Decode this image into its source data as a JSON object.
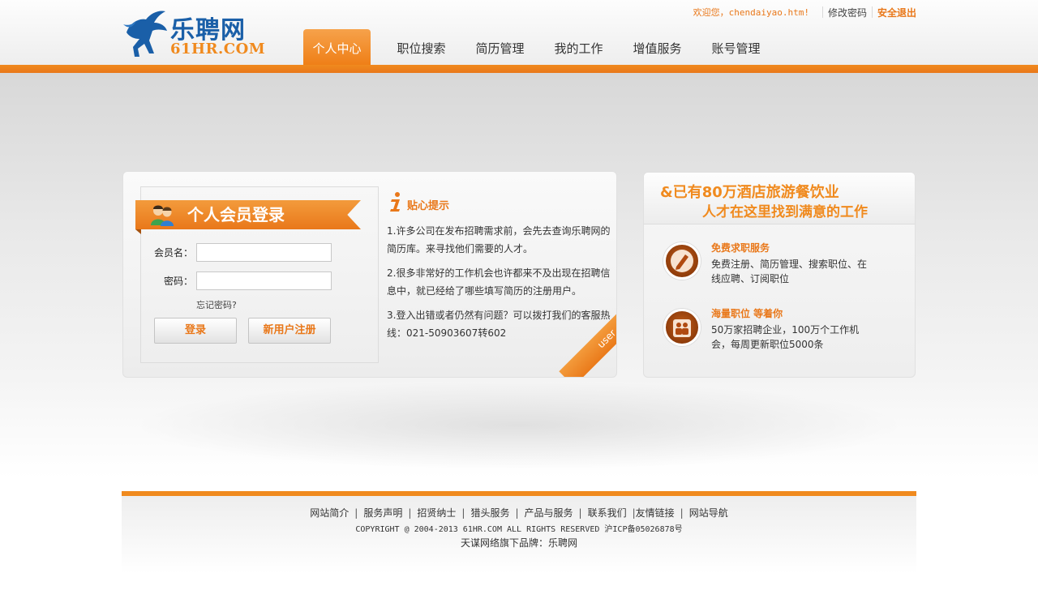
{
  "logo": {
    "cn": "乐聘网",
    "en": "61HR.COM"
  },
  "topbar": {
    "welcome": "欢迎您，chendaiyao.htm!",
    "change_password": "修改密码",
    "logout": "安全退出"
  },
  "nav": {
    "tabs": [
      {
        "label": "个人中心"
      },
      {
        "label": "职位搜索"
      },
      {
        "label": "简历管理"
      },
      {
        "label": "我的工作"
      },
      {
        "label": "增值服务"
      },
      {
        "label": "账号管理"
      }
    ]
  },
  "login": {
    "title": "个人会员登录",
    "username_label": "会员名：",
    "password_label": "密码：",
    "forgot": "忘记密码?",
    "login_button": "登录",
    "register_button": "新用户注册",
    "corner_text": "user"
  },
  "tips": {
    "title": "贴心提示",
    "items": [
      "1.许多公司在发布招聘需求前，会先去查询乐聘网的简历库。来寻找他们需要的人才。",
      "2.很多非常好的工作机会也许都来不及出现在招聘信息中，就已经给了哪些填写简历的注册用户。",
      "3.登入出错或者仍然有问题？可以拨打我们的客服热线：021-50903607转602"
    ]
  },
  "promo": {
    "line1": "&已有80万酒店旅游餐饮业",
    "line2": "人才在这里找到满意的工作",
    "services": [
      {
        "icon": "pen-icon",
        "title": "免费求职服务",
        "desc": "免费注册、简历管理、搜索职位、在线应聘、订阅职位"
      },
      {
        "icon": "people-icon",
        "title": "海量职位 等着你",
        "desc": "50万家招聘企业，100万个工作机会，每周更新职位5000条"
      }
    ]
  },
  "footer": {
    "links": [
      "网站简介",
      "服务声明",
      "招贤纳士",
      "猎头服务",
      "产品与服务",
      "联系我们",
      "友情链接",
      "网站导航"
    ],
    "copyright": "COPYRIGHT @ 2004-2013 61HR.COM ALL RIGHTS RESERVED 沪ICP备05026878号",
    "brand": "天谋网络旗下品牌：乐聘网"
  },
  "colors": {
    "accent": "#f08a1e",
    "brand_blue": "#1a5fa8"
  }
}
